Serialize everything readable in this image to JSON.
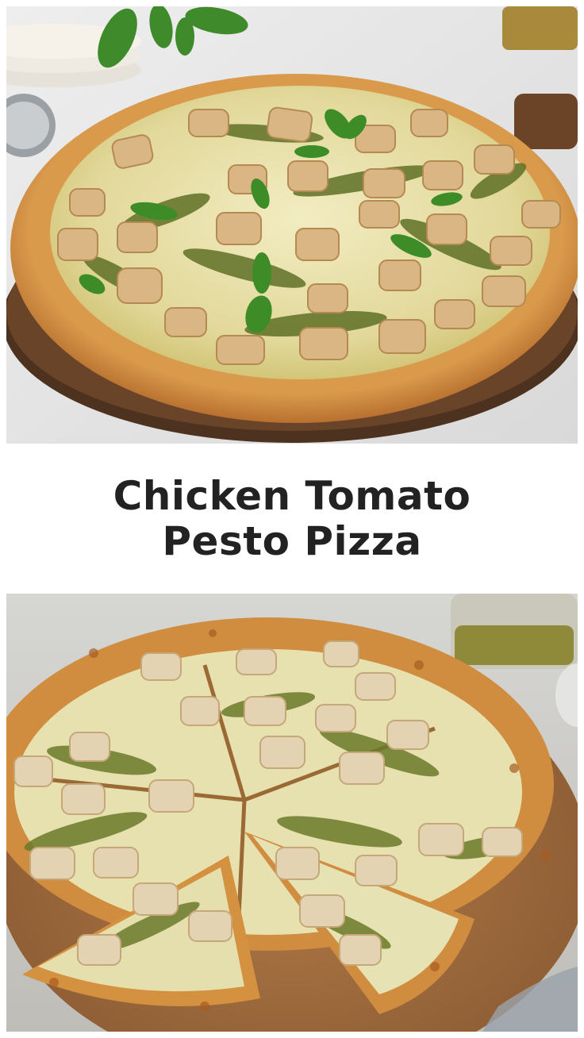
{
  "pin": {
    "title_lines": [
      "Chicken Tomato",
      "Pesto Pizza"
    ]
  },
  "images": {
    "top": {
      "subject": "whole pesto chicken pizza on wooden board"
    },
    "bottom": {
      "subject": "sliced pesto chicken pizza on wooden board"
    }
  },
  "colors": {
    "title_text": "#222222",
    "background": "#ffffff",
    "crust": "#cf8f44",
    "pesto": "#6b7a2c",
    "cheese": "#eee7b5",
    "board": "#5a3a22"
  }
}
